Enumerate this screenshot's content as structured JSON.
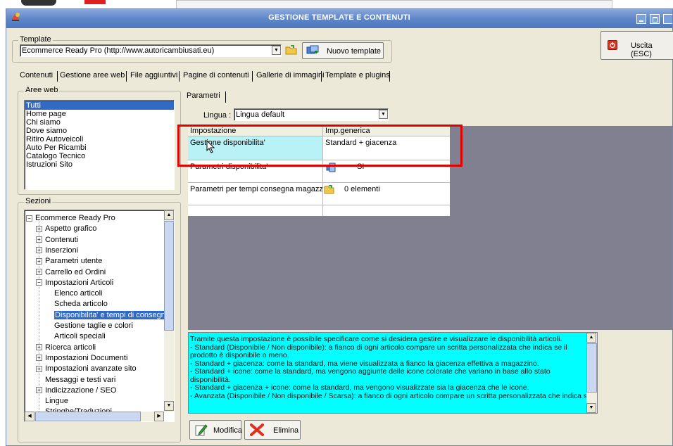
{
  "window": {
    "title": "GESTIONE TEMPLATE E CONTENUTI"
  },
  "template_group": {
    "label": "Template",
    "selected": "Ecommerce Ready Pro (http://www.autoricambiusati.eu)",
    "new_button": "Nuovo template"
  },
  "exit_button": "Uscita (ESC)",
  "tabs": [
    "Contenuti",
    "Gestione aree web",
    "File aggiuntivi",
    "Pagine di contenuti",
    "Gallerie di immagini",
    "Template e plugins"
  ],
  "aree_web": {
    "label": "Aree web",
    "items": [
      "Tutti",
      "Home page",
      "Chi siamo",
      "Dove siamo",
      "Ritiro Autoveicoli",
      "Auto Per Ricambi",
      "Catalogo Tecnico",
      "Istruzioni Sito"
    ]
  },
  "sezioni": {
    "label": "Sezioni",
    "tree": [
      {
        "label": "Ecommerce Ready Pro",
        "level": 0,
        "expander": "−"
      },
      {
        "label": "Aspetto grafico",
        "level": 1,
        "expander": "+"
      },
      {
        "label": "Contenuti",
        "level": 1,
        "expander": "+"
      },
      {
        "label": "Inserzioni",
        "level": 1,
        "expander": "+"
      },
      {
        "label": "Parametri utente",
        "level": 1,
        "expander": "+"
      },
      {
        "label": "Carrello ed Ordini",
        "level": 1,
        "expander": "+"
      },
      {
        "label": "Impostazioni Articoli",
        "level": 1,
        "expander": "−"
      },
      {
        "label": "Elenco articoli",
        "level": 2,
        "expander": ""
      },
      {
        "label": "Scheda articolo",
        "level": 2,
        "expander": ""
      },
      {
        "label": "Disponibilita' e tempi di consegna",
        "level": 2,
        "expander": "",
        "selected": true
      },
      {
        "label": "Gestione taglie e colori",
        "level": 2,
        "expander": ""
      },
      {
        "label": "Articoli speciali",
        "level": 2,
        "expander": ""
      },
      {
        "label": "Ricerca articoli",
        "level": 1,
        "expander": "+"
      },
      {
        "label": "Impostazioni Documenti",
        "level": 1,
        "expander": "+"
      },
      {
        "label": "Impostazioni avanzate sito",
        "level": 1,
        "expander": "+"
      },
      {
        "label": "Messaggi e testi vari",
        "level": 1,
        "expander": ""
      },
      {
        "label": "Indicizzazione / SEO",
        "level": 1,
        "expander": "+"
      },
      {
        "label": "Lingue",
        "level": 1,
        "expander": ""
      },
      {
        "label": "Stringhe/Traduzioni",
        "level": 1,
        "expander": ""
      }
    ]
  },
  "parametri": {
    "tab": "Parametri",
    "lingua_label": "Lingua :",
    "lingua_value": "Lingua default",
    "col1": "Impostazione",
    "col2": "Imp.generica",
    "rows": [
      {
        "name": "Gestione disponibilita'",
        "value": "Standard + giacenza"
      },
      {
        "name": "Parametri disponibilita'",
        "value": "SI"
      },
      {
        "name": "Parametri per tempi consegna magazzini",
        "value": "0 elementi"
      }
    ]
  },
  "description": [
    "Tramite questa impostazione è possibile specificare come si desidera gestire e visualizzare le disponibilità articoli.",
    "- Standard (Disponibile / Non disponibile): a fianco di ogni articolo compare un scritta personalizzata che indica se il",
    "prodotto è disponibile o meno.",
    "- Standard + giacenza: come la standard, ma viene visualizzata a fianco la giacenza effettiva a magazzino.",
    "- Standard + icone: come la standard, ma vengono aggiunte delle icone colorate che variano in base allo stato",
    "disponibilità.",
    "- Standard + giacenza + icone: come la standard, ma vengono visualizzate sia la giacenza che le icone.",
    "- Avanzata (Disponibile / Non disponibile / Scarsa): a fianco di ogni articolo compare un scritta personalizzata che indica se"
  ],
  "buttons": {
    "modifica": "Modifica",
    "elimina": "Elimina"
  },
  "colors": {
    "titlebar": "#5f86c9",
    "selection": "#316ac5",
    "highlight_cell": "#b8f2f7",
    "description_bg": "#00ffff",
    "red_box": "#e00000",
    "panel": "#ece9d8"
  }
}
